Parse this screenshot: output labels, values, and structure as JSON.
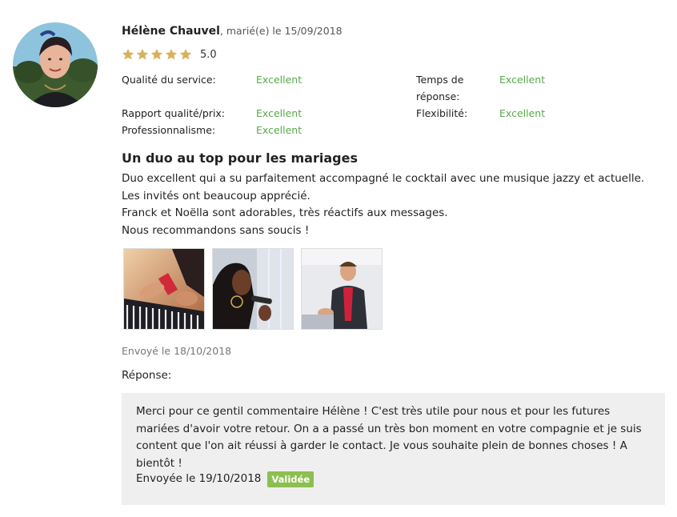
{
  "review": {
    "author": "Hélène Chauvel",
    "meta": ", marié(e) le 15/09/2018",
    "rating_value": "5.0",
    "stars": 5,
    "criteria": [
      {
        "label": "Qualité du service:",
        "value": "Excellent"
      },
      {
        "label": "Temps de réponse:",
        "value": "Excellent"
      },
      {
        "label": "Rapport qualité/prix:",
        "value": "Excellent"
      },
      {
        "label": "Flexibilité:",
        "value": "Excellent"
      },
      {
        "label": "Professionnalisme:",
        "value": "Excellent"
      }
    ],
    "title": "Un duo au top pour les mariages",
    "body": [
      "Duo excellent qui a su parfaitement accompagné le cocktail avec une musique jazzy et actuelle. Les invités ont beaucoup apprécié.",
      "Franck et Noëlla sont adorables, très réactifs aux messages.",
      "Nous recommandons sans soucis !"
    ],
    "sent": "Envoyé le 18/10/2018"
  },
  "response": {
    "label": "Réponse:",
    "text": "Merci pour ce gentil commentaire Hélène ! C'est très utile pour nous et pour les futures mariées d'avoir votre retour. On a a passé un très bon moment en votre compagnie et je suis content que l'on ait réussi à garder le contact. Je vous souhaite plein de bonnes choses ! A bientôt !",
    "sent": "Envoyée le 19/10/2018",
    "status": "Validée"
  },
  "colors": {
    "star": "#d9b15a",
    "excellent": "#58a94a",
    "badge": "#8cbf4f",
    "reply_bg": "#efefef"
  }
}
